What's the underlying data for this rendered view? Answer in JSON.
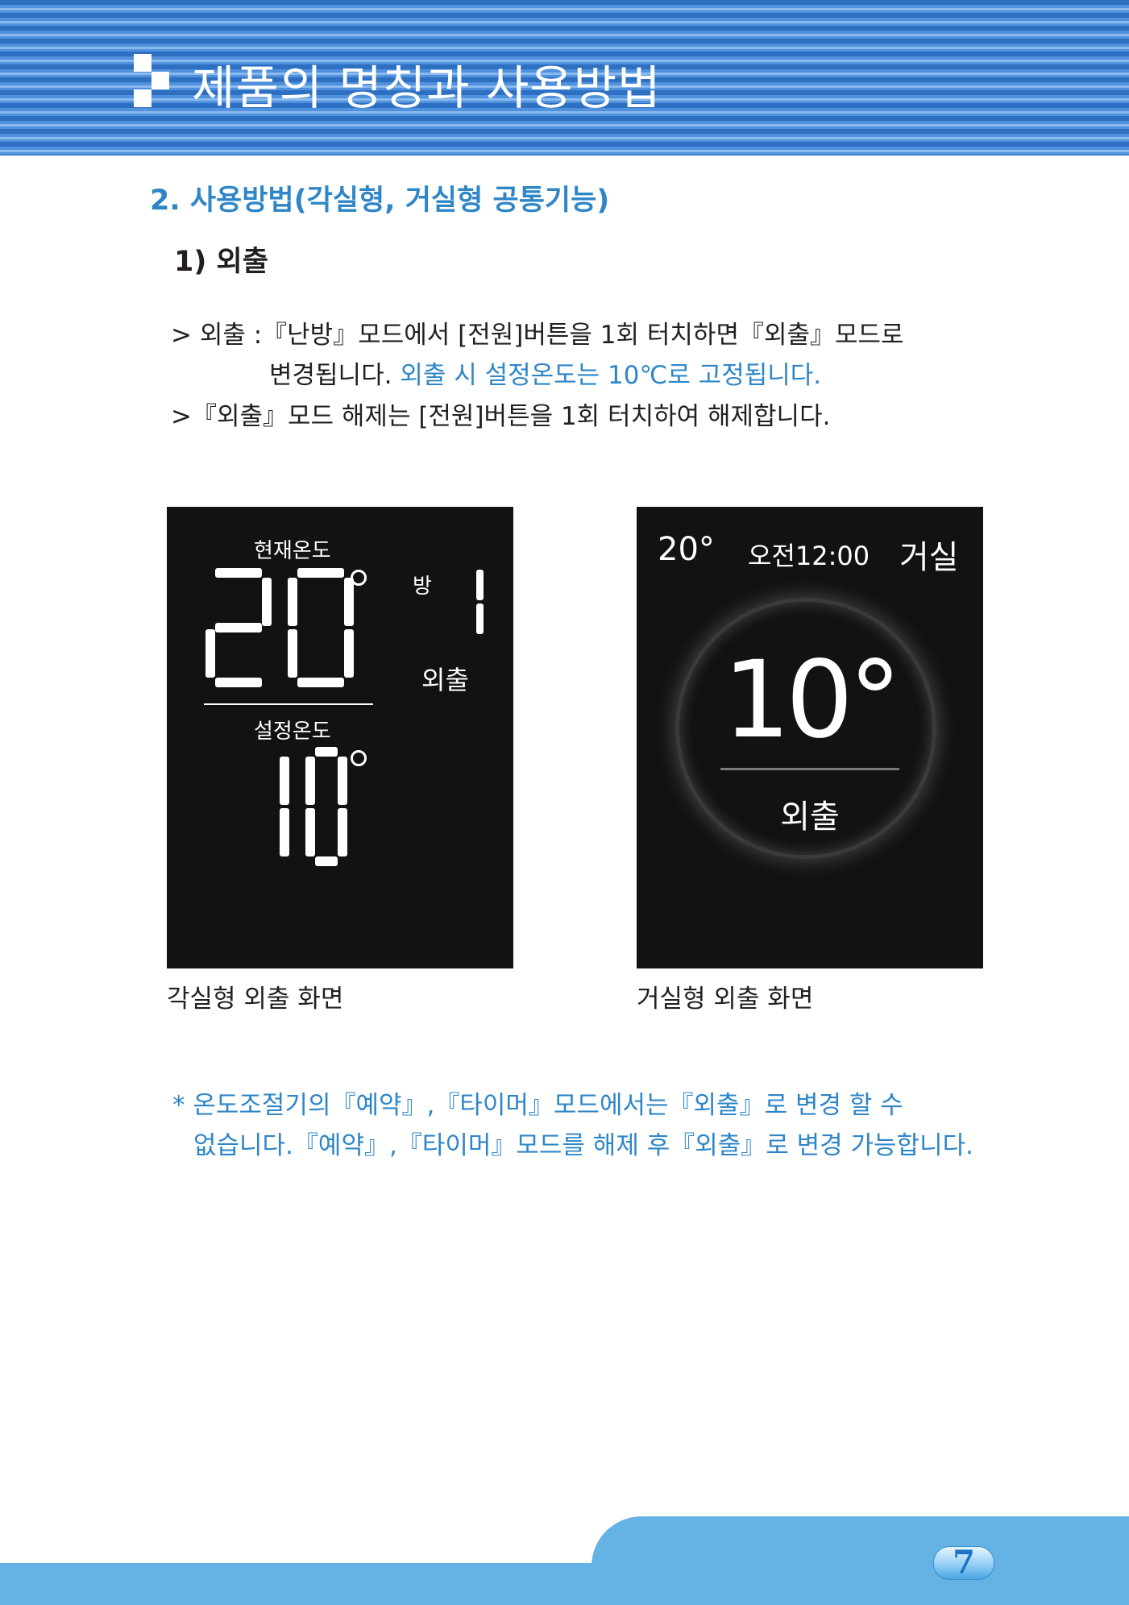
{
  "header": {
    "title": "제품의 명칭과 사용방법"
  },
  "section": {
    "title": "2. 사용방법(각실형, 거실형 공통기능)",
    "subtitle": "1) 외출"
  },
  "instructions": {
    "line1": "> 외출 :『난방』모드에서 [전원]버튼을 1회 터치하면『외출』모드로",
    "line2_black": "변경됩니다.",
    "line2_blue": " 외출 시 설정온도는 10℃로 고정됩니다.",
    "line3": ">『외출』모드 해제는 [전원]버튼을 1회 터치하여 해제합니다."
  },
  "room_screen": {
    "current_label": "현재온도",
    "current_temp": "20",
    "room_label": "방",
    "room_number": "1",
    "mode": "외출",
    "set_label": "설정온도",
    "set_temp": "10",
    "caption": "각실형 외출 화면"
  },
  "living_screen": {
    "current_temp": "20°",
    "time": "오전12:00",
    "location": "거실",
    "set_temp": "10°",
    "mode": "외출",
    "caption": "거실형 외출 화면"
  },
  "notes": {
    "line1": "* 온도조절기의『예약』,『타이머』모드에서는『외출』로 변경 할 수",
    "line2": "없습니다.『예약』,『타이머』모드를 해제 후『외출』로 변경 가능합니다."
  },
  "footer": {
    "page_number": "7"
  },
  "colors": {
    "accent_blue": "#2f86c7",
    "header_blue": "#2d6fc0",
    "footer_blue": "#64b3e4",
    "screen_bg": "#121212"
  }
}
